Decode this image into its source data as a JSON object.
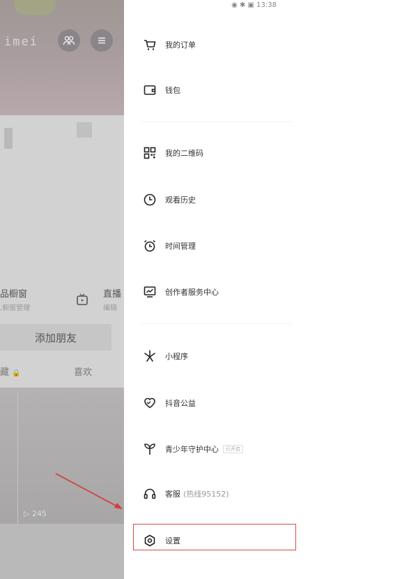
{
  "background_profile": {
    "name_partial": "imei",
    "showcase_label": "品橱窗",
    "showcase_sub": ",橱窗管理",
    "live_label": "直播",
    "live_sub": "编辑",
    "add_friend": "添加朋友",
    "tab_collect": "藏",
    "tab_like": "喜欢",
    "play_count": "245"
  },
  "status_bar": {
    "time": "13:38"
  },
  "menu": {
    "group1": [
      {
        "icon": "cart-icon",
        "label": "我的订单"
      },
      {
        "icon": "wallet-icon",
        "label": "钱包"
      }
    ],
    "group2": [
      {
        "icon": "qrcode-icon",
        "label": "我的二维码"
      },
      {
        "icon": "history-icon",
        "label": "观看历史"
      },
      {
        "icon": "alarm-icon",
        "label": "时间管理"
      },
      {
        "icon": "creator-icon",
        "label": "创作者服务中心"
      }
    ],
    "group3": [
      {
        "icon": "miniprogram-icon",
        "label": "小程序"
      },
      {
        "icon": "charity-icon",
        "label": "抖音公益"
      },
      {
        "icon": "sprout-icon",
        "label": "青少年守护中心",
        "tag": "已开启"
      },
      {
        "icon": "headset-icon",
        "label": "客服",
        "extra": "(热线95152)"
      },
      {
        "icon": "settings-icon",
        "label": "设置"
      }
    ]
  },
  "colors": {
    "highlight_border": "#d24b4b",
    "arrow": "#d63a3a"
  }
}
